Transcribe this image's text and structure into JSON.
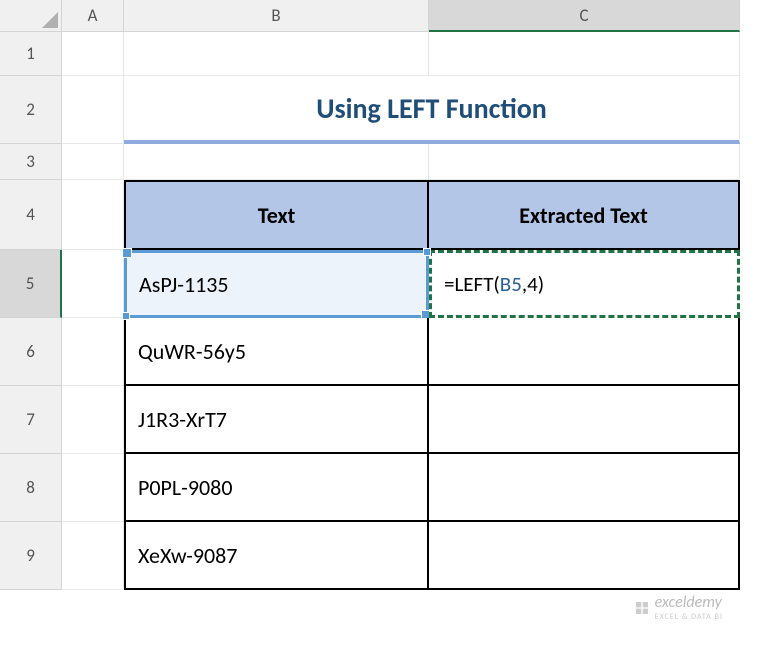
{
  "columns": [
    "A",
    "B",
    "C"
  ],
  "rows": [
    "1",
    "2",
    "3",
    "4",
    "5",
    "6",
    "7",
    "8",
    "9"
  ],
  "title": "Using LEFT Function",
  "table": {
    "headers": {
      "text": "Text",
      "extracted": "Extracted Text"
    },
    "data": [
      {
        "text": "AsPJ-1135",
        "extracted": ""
      },
      {
        "text": "QuWR-56y5",
        "extracted": ""
      },
      {
        "text": "J1R3-XrT7",
        "extracted": ""
      },
      {
        "text": "P0PL-9080",
        "extracted": ""
      },
      {
        "text": "XeXw-9087",
        "extracted": ""
      }
    ]
  },
  "formula": {
    "prefix": "=LEFT(",
    "ref": "B5",
    "suffix": ",4)"
  },
  "watermark": {
    "name": "exceldemy",
    "sub": "EXCEL & DATA BI"
  },
  "active_row": "5",
  "active_col": "C"
}
